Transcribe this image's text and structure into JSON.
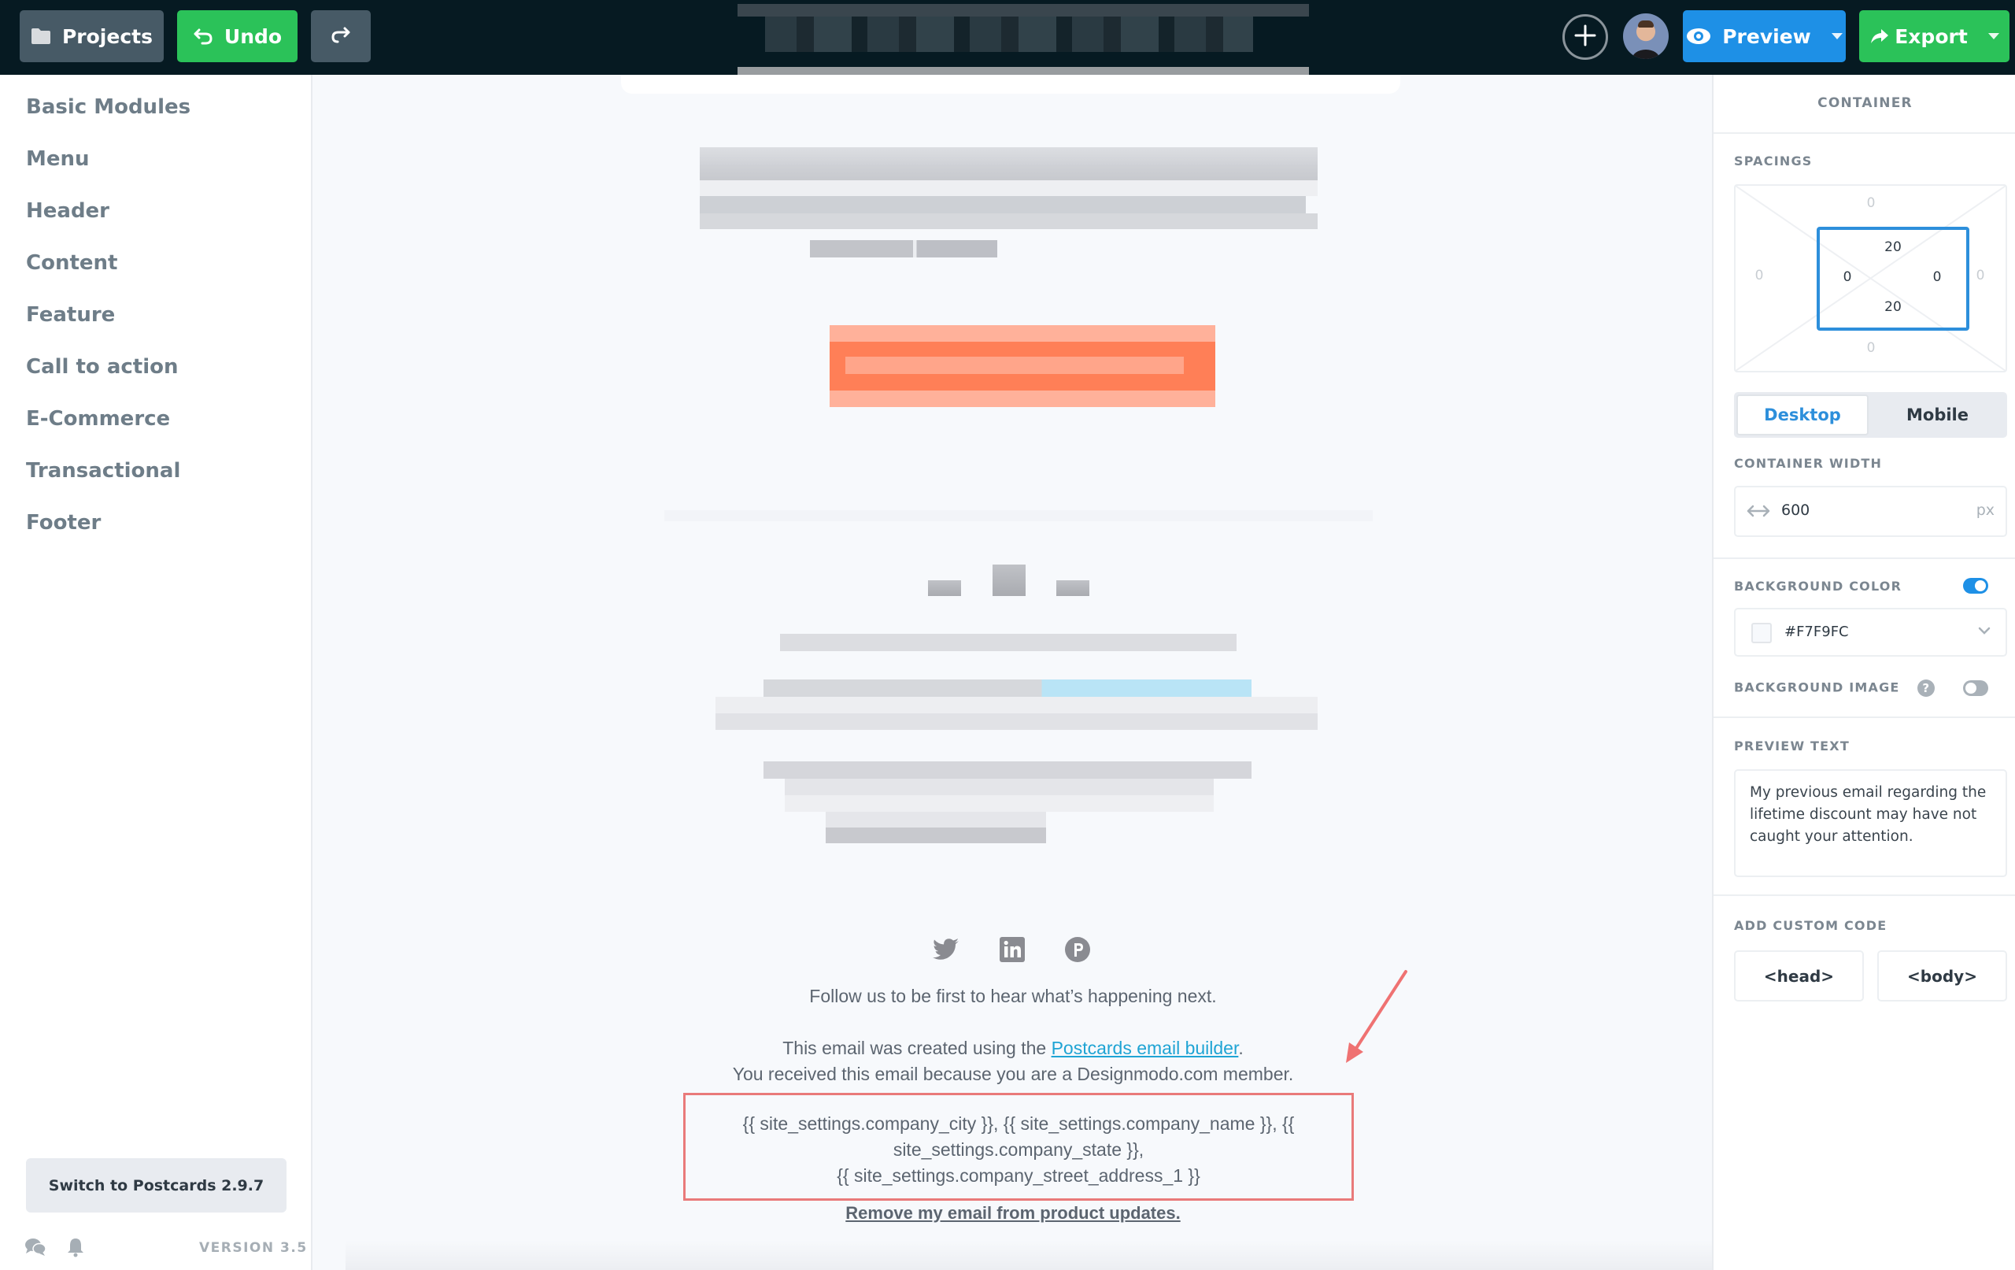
{
  "topbar": {
    "projects_label": "Projects",
    "undo_label": "Undo",
    "preview_label": "Preview",
    "export_label": "Export",
    "icons": {
      "projects": "folder-icon",
      "undo": "undo-icon",
      "redo": "redo-icon",
      "add": "plus-icon",
      "preview": "eye-icon",
      "export": "share-arrow-icon"
    }
  },
  "sidebar": {
    "items": [
      {
        "label": "Basic Modules"
      },
      {
        "label": "Menu"
      },
      {
        "label": "Header"
      },
      {
        "label": "Content"
      },
      {
        "label": "Feature"
      },
      {
        "label": "Call to action"
      },
      {
        "label": "E-Commerce"
      },
      {
        "label": "Transactional"
      },
      {
        "label": "Footer"
      }
    ],
    "switch_label": "Switch to Postcards 2.9.7",
    "version": "VERSION 3.5"
  },
  "canvas": {
    "colors": {
      "background": "#F7F9FC",
      "cta": "#FF7F57",
      "link": "#1FA4D4",
      "annotation": "#E97A7A"
    },
    "follow_text": "Follow us to be first to hear what’s happening next.",
    "created_prefix": "This email was created using the ",
    "created_link": "Postcards email builder",
    "created_suffix": ".",
    "member_text": "You received this email because you are a Designmodo.com member.",
    "address_lines": [
      "{{ site_settings.company_city }}, {{ site_settings.company_name }}, {{",
      "site_settings.company_state }},",
      "{{ site_settings.company_street_address_1 }}"
    ],
    "remove_link": "Remove my email from product updates.",
    "social": [
      "twitter-icon",
      "linkedin-icon",
      "pinterest-icon"
    ]
  },
  "panel": {
    "title": "CONTAINER",
    "spacings_label": "SPACINGS",
    "spacing": {
      "margin": {
        "top": "0",
        "right": "0",
        "bottom": "0",
        "left": "0"
      },
      "padding": {
        "top": "20",
        "right": "0",
        "bottom": "20",
        "left": "0"
      }
    },
    "tabs": {
      "desktop": "Desktop",
      "mobile": "Mobile",
      "active": "Desktop"
    },
    "width_label": "CONTAINER WIDTH",
    "width_value": "600",
    "width_unit": "px",
    "bg_color_label": "BACKGROUND COLOR",
    "bg_color_enabled": true,
    "bg_color_value": "#F7F9FC",
    "bg_image_label": "BACKGROUND IMAGE",
    "bg_image_enabled": false,
    "preview_text_label": "PREVIEW TEXT",
    "preview_text": "My previous email regarding the lifetime discount may have not caught your attention.",
    "custom_code_label": "ADD CUSTOM CODE",
    "head_label": "<head>",
    "body_label": "<body>"
  }
}
